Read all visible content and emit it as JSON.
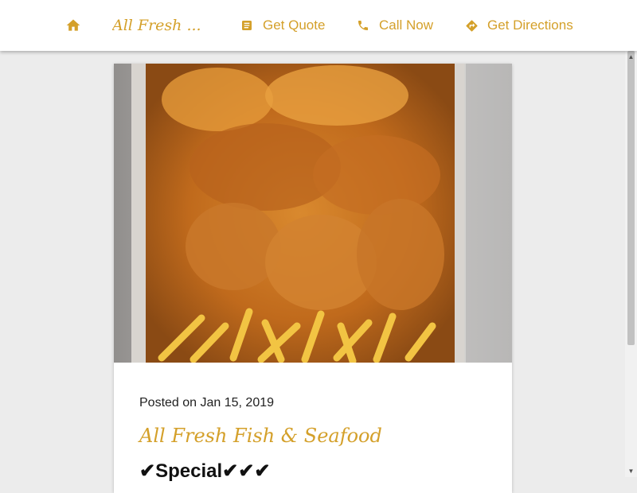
{
  "nav": {
    "home_icon": "home-icon",
    "brand": "All Fresh ...",
    "quote": {
      "icon": "document-icon",
      "label": "Get Quote"
    },
    "call": {
      "icon": "phone-icon",
      "label": "Call Now"
    },
    "directions": {
      "icon": "directions-icon",
      "label": "Get Directions"
    }
  },
  "post": {
    "image_desc": "photo",
    "posted": "Posted on Jan 15, 2019",
    "title": "All Fresh Fish & Seafood",
    "body": "✔Special✔✔✔"
  },
  "colors": {
    "accent": "#d4a02a",
    "topbar": "#ffffff",
    "background": "#ececec"
  }
}
